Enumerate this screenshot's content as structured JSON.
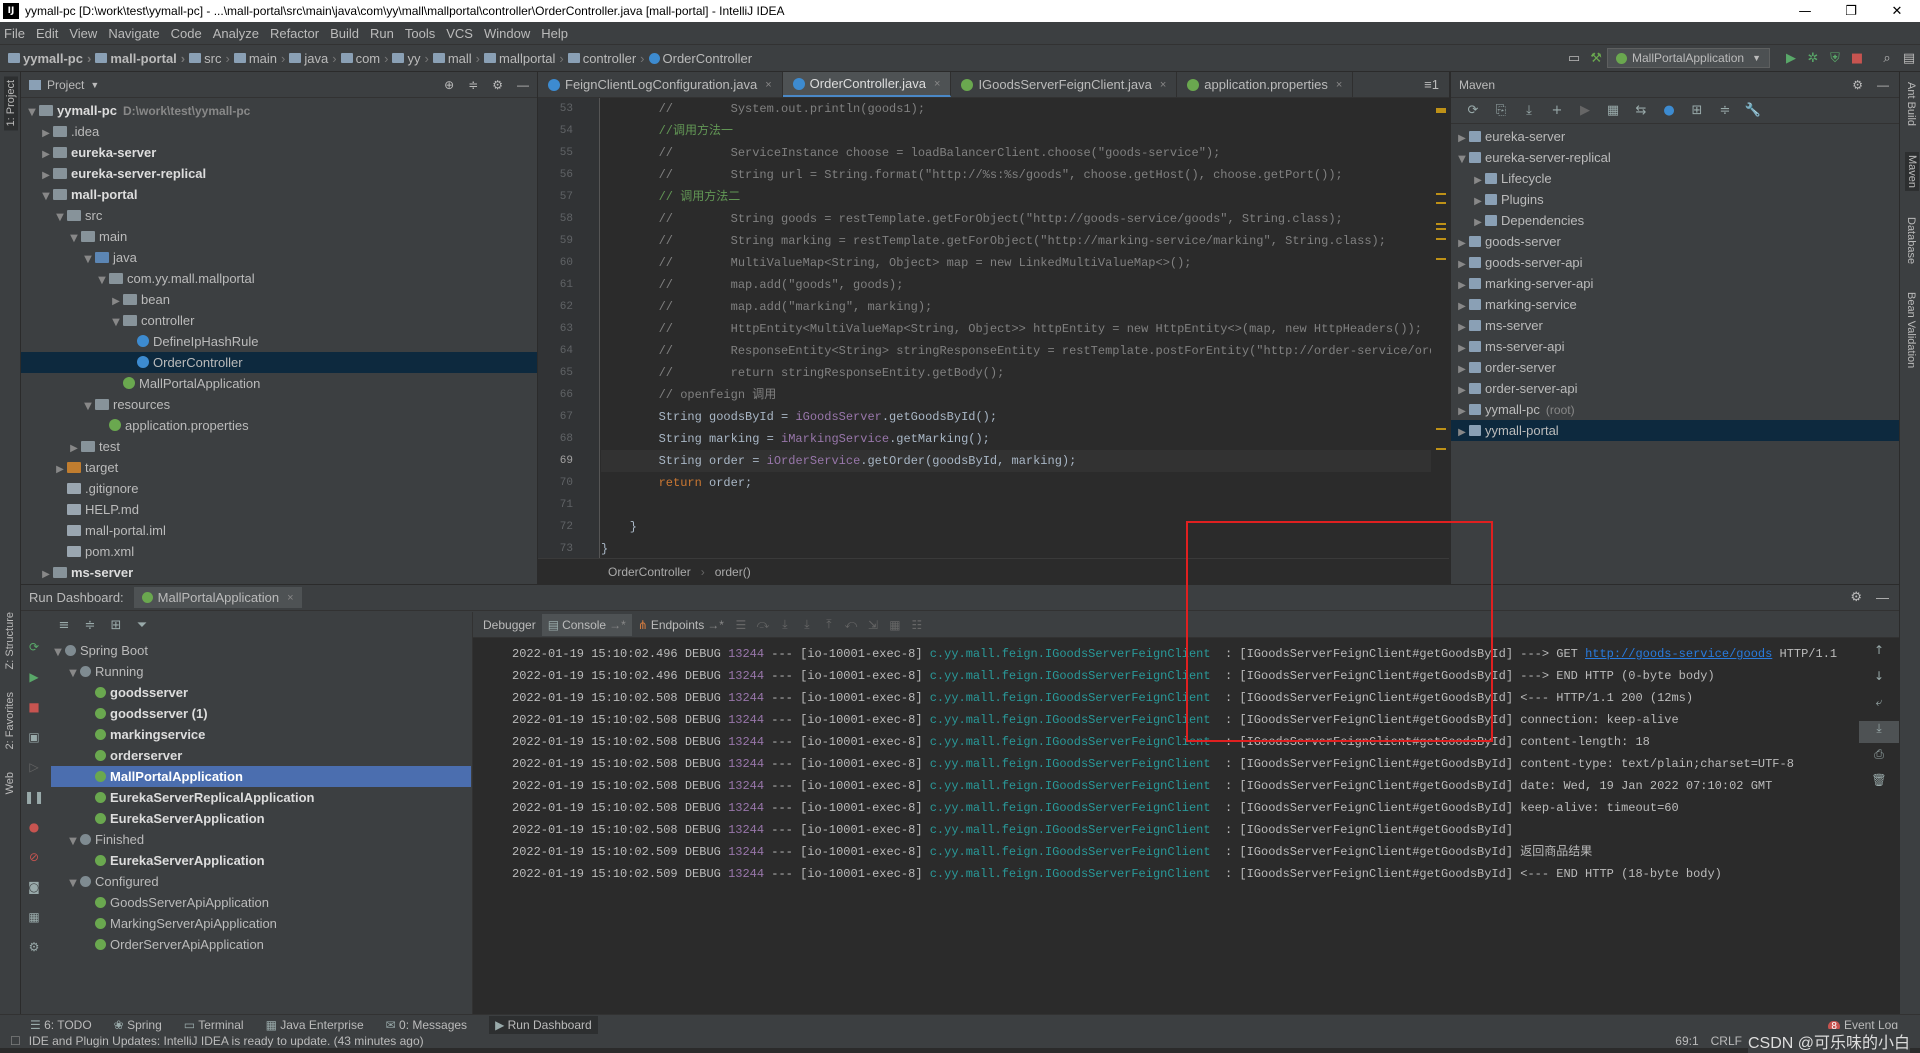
{
  "window": {
    "title": "yymall-pc [D:\\work\\test\\yymall-pc] - ...\\mall-portal\\src\\main\\java\\com\\yy\\mall\\mallportal\\controller\\OrderController.java [mall-portal] - IntelliJ IDEA",
    "logo": "IJ",
    "min": "—",
    "max": "❐",
    "close": "✕"
  },
  "menu": [
    "File",
    "Edit",
    "View",
    "Navigate",
    "Code",
    "Analyze",
    "Refactor",
    "Build",
    "Run",
    "Tools",
    "VCS",
    "Window",
    "Help"
  ],
  "breadcrumbs": [
    "yymall-pc",
    "mall-portal",
    "src",
    "main",
    "java",
    "com",
    "yy",
    "mall",
    "mallportal",
    "controller",
    "OrderController"
  ],
  "run_config": "MallPortalApplication",
  "left_stripe": {
    "project": "1: Project",
    "structure": "Z: Structure",
    "favorites": "2: Favorites",
    "web": "Web"
  },
  "right_stripe": {
    "ant": "Ant Build",
    "maven": "Maven",
    "database": "Database",
    "bean": "Bean Validation"
  },
  "project_panel": {
    "title": "Project",
    "tree": [
      {
        "label": "yymall-pc",
        "hint": "D:\\work\\test\\yymall-pc",
        "depth": 0,
        "arrow": "▼",
        "icon": "folder",
        "bold": true
      },
      {
        "label": ".idea",
        "depth": 1,
        "arrow": "▶",
        "icon": "folder"
      },
      {
        "label": "eureka-server",
        "depth": 1,
        "arrow": "▶",
        "icon": "folder",
        "bold": true
      },
      {
        "label": "eureka-server-replical",
        "depth": 1,
        "arrow": "▶",
        "icon": "folder",
        "bold": true
      },
      {
        "label": "mall-portal",
        "depth": 1,
        "arrow": "▼",
        "icon": "folder",
        "bold": true
      },
      {
        "label": "src",
        "depth": 2,
        "arrow": "▼",
        "icon": "folder"
      },
      {
        "label": "main",
        "depth": 3,
        "arrow": "▼",
        "icon": "folder"
      },
      {
        "label": "java",
        "depth": 4,
        "arrow": "▼",
        "icon": "jfolder"
      },
      {
        "label": "com.yy.mall.mallportal",
        "depth": 5,
        "arrow": "▼",
        "icon": "folder"
      },
      {
        "label": "bean",
        "depth": 6,
        "arrow": "▶",
        "icon": "folder"
      },
      {
        "label": "controller",
        "depth": 6,
        "arrow": "▼",
        "icon": "folder"
      },
      {
        "label": "DefineIpHashRule",
        "depth": 7,
        "arrow": "",
        "icon": "jcls"
      },
      {
        "label": "OrderController",
        "depth": 7,
        "arrow": "",
        "icon": "jcls",
        "selected": true
      },
      {
        "label": "MallPortalApplication",
        "depth": 6,
        "arrow": "",
        "icon": "spring"
      },
      {
        "label": "resources",
        "depth": 4,
        "arrow": "▼",
        "icon": "folder"
      },
      {
        "label": "application.properties",
        "depth": 5,
        "arrow": "",
        "icon": "spring"
      },
      {
        "label": "test",
        "depth": 3,
        "arrow": "▶",
        "icon": "folder"
      },
      {
        "label": "target",
        "depth": 2,
        "arrow": "▶",
        "icon": "orange"
      },
      {
        "label": ".gitignore",
        "depth": 2,
        "arrow": "",
        "icon": "file"
      },
      {
        "label": "HELP.md",
        "depth": 2,
        "arrow": "",
        "icon": "file"
      },
      {
        "label": "mall-portal.iml",
        "depth": 2,
        "arrow": "",
        "icon": "file"
      },
      {
        "label": "pom.xml",
        "depth": 2,
        "arrow": "",
        "icon": "file"
      },
      {
        "label": "ms-server",
        "depth": 1,
        "arrow": "▶",
        "icon": "folder",
        "bold": true
      }
    ]
  },
  "editor": {
    "tabs": [
      {
        "label": "FeignClientLogConfiguration.java",
        "color": "#3d8bd0"
      },
      {
        "label": "OrderController.java",
        "color": "#3d8bd0",
        "active": true
      },
      {
        "label": "IGoodsServerFeignClient.java",
        "color": "#6aa84f"
      },
      {
        "label": "application.properties",
        "color": "#6aa84f"
      }
    ],
    "tab_close": "×",
    "line_numbers": [
      "53",
      "54",
      "55",
      "56",
      "57",
      "58",
      "59",
      "60",
      "61",
      "62",
      "63",
      "64",
      "65",
      "66",
      "67",
      "68",
      "69",
      "70",
      "71",
      "72",
      "73"
    ],
    "current_line": "69",
    "code_lines": [
      [
        {
          "t": "        //        ",
          "c": "cm"
        },
        {
          "t": "System.out.println(goods1);",
          "c": "cm"
        }
      ],
      [
        {
          "t": "        //调用方法一",
          "c": "cmz"
        }
      ],
      [
        {
          "t": "        //        ",
          "c": "cm"
        },
        {
          "t": "ServiceInstance choose = loadBalancerClient.choose(\"goods-service\");",
          "c": "cm"
        }
      ],
      [
        {
          "t": "        //        ",
          "c": "cm"
        },
        {
          "t": "String url = String.format(\"http://%s:%s/goods\", choose.getHost(), choose.getPort());",
          "c": "cm"
        }
      ],
      [
        {
          "t": "        // 调用方法二",
          "c": "cmz"
        }
      ],
      [
        {
          "t": "        //        ",
          "c": "cm"
        },
        {
          "t": "String goods = restTemplate.getForObject(\"http://goods-service/goods\", String.class);",
          "c": "cm"
        }
      ],
      [
        {
          "t": "        //        ",
          "c": "cm"
        },
        {
          "t": "String marking = restTemplate.getForObject(\"http://marking-service/marking\", String.class);",
          "c": "cm"
        }
      ],
      [
        {
          "t": "        //        ",
          "c": "cm"
        },
        {
          "t": "MultiValueMap<String, Object> map = new LinkedMultiValueMap<>();",
          "c": "cm"
        }
      ],
      [
        {
          "t": "        //        ",
          "c": "cm"
        },
        {
          "t": "map.add(\"goods\", goods);",
          "c": "cm"
        }
      ],
      [
        {
          "t": "        //        ",
          "c": "cm"
        },
        {
          "t": "map.add(\"marking\", marking);",
          "c": "cm"
        }
      ],
      [
        {
          "t": "        //        ",
          "c": "cm"
        },
        {
          "t": "HttpEntity<MultiValueMap<String, Object>> httpEntity = new HttpEntity<>(map, new HttpHeaders());",
          "c": "cm"
        }
      ],
      [
        {
          "t": "        //        ",
          "c": "cm"
        },
        {
          "t": "ResponseEntity<String> stringResponseEntity = restTemplate.postForEntity(\"http://order-service/order\", httpEnti",
          "c": "cm"
        }
      ],
      [
        {
          "t": "        //        ",
          "c": "cm"
        },
        {
          "t": "return stringResponseEntity.getBody();",
          "c": "cm"
        }
      ],
      [
        {
          "t": "        // openfeign 调用",
          "c": "cm"
        }
      ],
      [
        {
          "t": "        String goodsById = ",
          "c": ""
        },
        {
          "t": "iGoodsServer",
          "c": "fld"
        },
        {
          "t": ".getGoodsById();",
          "c": ""
        }
      ],
      [
        {
          "t": "        String marking = ",
          "c": ""
        },
        {
          "t": "iMarkingService",
          "c": "fld"
        },
        {
          "t": ".getMarking();",
          "c": ""
        }
      ],
      [
        {
          "t": "        String ",
          "c": ""
        },
        {
          "t": "order",
          "c": ""
        },
        {
          "t": " = ",
          "c": ""
        },
        {
          "t": "iOrderService",
          "c": "fld"
        },
        {
          "t": ".getOrder(goodsById, marking);",
          "c": ""
        }
      ],
      [
        {
          "t": "        ",
          "c": ""
        },
        {
          "t": "return",
          "c": "kw"
        },
        {
          "t": " order;",
          "c": ""
        }
      ],
      [
        {
          "t": "",
          "c": ""
        }
      ],
      [
        {
          "t": "    }",
          "c": ""
        }
      ],
      [
        {
          "t": "}",
          "c": ""
        }
      ]
    ],
    "breadcrumb": [
      "OrderController",
      "order()"
    ]
  },
  "maven": {
    "title": "Maven",
    "tree": [
      {
        "label": "eureka-server",
        "depth": 0,
        "arrow": "▶"
      },
      {
        "label": "eureka-server-replical",
        "depth": 0,
        "arrow": "▼"
      },
      {
        "label": "Lifecycle",
        "depth": 1,
        "arrow": "▶"
      },
      {
        "label": "Plugins",
        "depth": 1,
        "arrow": "▶"
      },
      {
        "label": "Dependencies",
        "depth": 1,
        "arrow": "▶"
      },
      {
        "label": "goods-server",
        "depth": 0,
        "arrow": "▶"
      },
      {
        "label": "goods-server-api",
        "depth": 0,
        "arrow": "▶"
      },
      {
        "label": "marking-server-api",
        "depth": 0,
        "arrow": "▶"
      },
      {
        "label": "marking-service",
        "depth": 0,
        "arrow": "▶"
      },
      {
        "label": "ms-server",
        "depth": 0,
        "arrow": "▶"
      },
      {
        "label": "ms-server-api",
        "depth": 0,
        "arrow": "▶"
      },
      {
        "label": "order-server",
        "depth": 0,
        "arrow": "▶"
      },
      {
        "label": "order-server-api",
        "depth": 0,
        "arrow": "▶"
      },
      {
        "label": "yymall-pc",
        "hint": "(root)",
        "depth": 0,
        "arrow": "▶"
      },
      {
        "label": "yymall-portal",
        "depth": 0,
        "arrow": "▶",
        "selected": true
      }
    ]
  },
  "run_dashboard": {
    "title": "Run Dashboard:",
    "chip": "MallPortalApplication",
    "tree": [
      {
        "label": "Spring Boot",
        "depth": 0,
        "arrow": "▼",
        "icon": "g"
      },
      {
        "label": "Running",
        "depth": 1,
        "arrow": "▼",
        "icon": "g"
      },
      {
        "label": "goodsserver",
        "depth": 2,
        "bold": true
      },
      {
        "label": "goodsserver (1)",
        "depth": 2,
        "bold": true
      },
      {
        "label": "markingservice",
        "depth": 2,
        "bold": true
      },
      {
        "label": "orderserver",
        "depth": 2,
        "bold": true
      },
      {
        "label": "MallPortalApplication",
        "depth": 2,
        "bold": true,
        "selected": true
      },
      {
        "label": "EurekaServerReplicalApplication",
        "depth": 2,
        "bold": true
      },
      {
        "label": "EurekaServerApplication",
        "depth": 2,
        "bold": true
      },
      {
        "label": "Finished",
        "depth": 1,
        "arrow": "▼",
        "icon": "g"
      },
      {
        "label": "EurekaServerApplication",
        "depth": 2,
        "bold": true
      },
      {
        "label": "Configured",
        "depth": 1,
        "arrow": "▼",
        "icon": "g"
      },
      {
        "label": "GoodsServerApiApplication",
        "depth": 2
      },
      {
        "label": "MarkingServerApiApplication",
        "depth": 2
      },
      {
        "label": "OrderServerApiApplication",
        "depth": 2
      }
    ],
    "console_tabs": [
      "Debugger",
      "Console",
      "Endpoints"
    ],
    "log_prefix": {
      "thread": "[io-10001-exec-8]",
      "logger": "c.yy.mall.feign.IGoodsServerFeignClient",
      "method": "[IGoodsServerFeignClient#getGoodsById]",
      "level": "DEBUG",
      "pid": "13244",
      "dash": "---"
    },
    "log_lines": [
      {
        "time": "2022-01-19 15:10:02.496",
        "msg_pre": "---> GET ",
        "link": "http://goods-service/goods",
        "msg_post": " HTTP/1.1"
      },
      {
        "time": "2022-01-19 15:10:02.496",
        "msg_pre": "---> END HTTP (0-byte body)"
      },
      {
        "time": "2022-01-19 15:10:02.508",
        "msg_pre": "<--- HTTP/1.1 200 (12ms)"
      },
      {
        "time": "2022-01-19 15:10:02.508",
        "msg_pre": "connection: keep-alive"
      },
      {
        "time": "2022-01-19 15:10:02.508",
        "msg_pre": "content-length: 18"
      },
      {
        "time": "2022-01-19 15:10:02.508",
        "msg_pre": "content-type: text/plain;charset=UTF-8"
      },
      {
        "time": "2022-01-19 15:10:02.508",
        "msg_pre": "date: Wed, 19 Jan 2022 07:10:02 GMT"
      },
      {
        "time": "2022-01-19 15:10:02.508",
        "msg_pre": "keep-alive: timeout=60"
      },
      {
        "time": "2022-01-19 15:10:02.508",
        "msg_pre": ""
      },
      {
        "time": "2022-01-19 15:10:02.509",
        "msg_pre": "返回商品结果"
      },
      {
        "time": "2022-01-19 15:10:02.509",
        "msg_pre": "<--- END HTTP (18-byte body)"
      }
    ]
  },
  "bottom_tabs": [
    "6: TODO",
    "Spring",
    "Terminal",
    "Java Enterprise",
    "0: Messages",
    "Run Dashboard"
  ],
  "event_log": "Event Log",
  "event_count": "8",
  "status": {
    "message": "IDE and Plugin Updates: IntelliJ IDEA is ready to update. (43 minutes ago)",
    "position": "69:1",
    "encoding": "CRLF",
    "watermark": "CSDN @可乐味的小白"
  }
}
